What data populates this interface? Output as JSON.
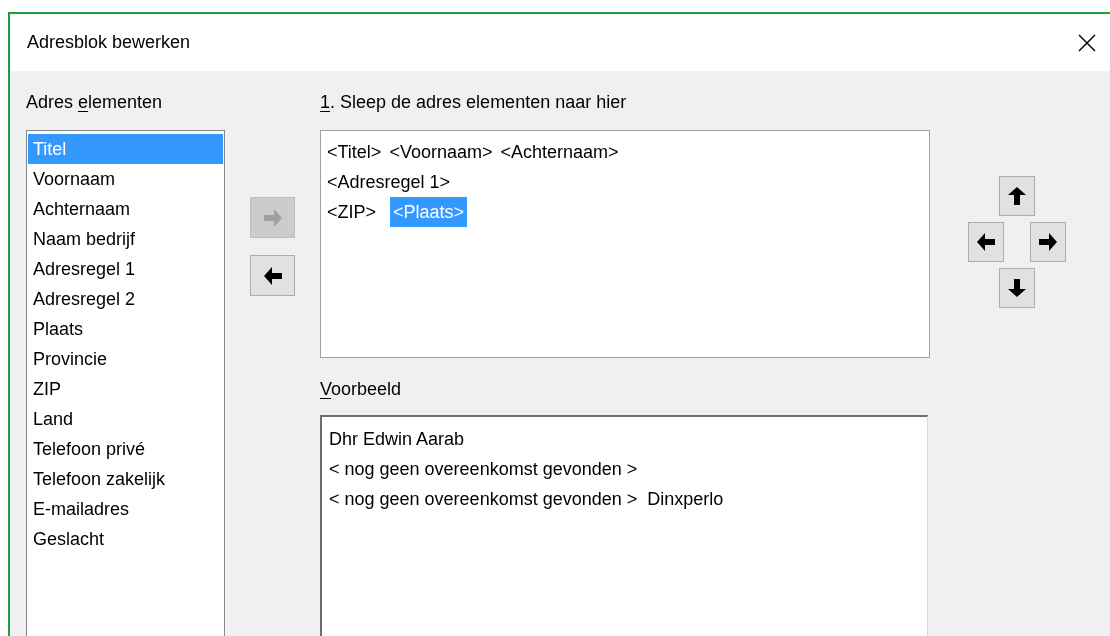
{
  "window": {
    "title": "Adresblok bewerken"
  },
  "elements_label": {
    "before": "Adres ",
    "access_key": "e",
    "after": "lementen"
  },
  "elements": [
    {
      "label": "Titel",
      "selected": true
    },
    {
      "label": "Voornaam",
      "selected": false
    },
    {
      "label": "Achternaam",
      "selected": false
    },
    {
      "label": "Naam bedrijf",
      "selected": false
    },
    {
      "label": "Adresregel 1",
      "selected": false
    },
    {
      "label": "Adresregel 2",
      "selected": false
    },
    {
      "label": "Plaats",
      "selected": false
    },
    {
      "label": "Provincie",
      "selected": false
    },
    {
      "label": "ZIP",
      "selected": false
    },
    {
      "label": "Land",
      "selected": false
    },
    {
      "label": "Telefoon privé",
      "selected": false
    },
    {
      "label": "Telefoon zakelijk",
      "selected": false
    },
    {
      "label": "E-mailadres",
      "selected": false
    },
    {
      "label": "Geslacht",
      "selected": false
    }
  ],
  "transfer_buttons": [
    {
      "kind": "add",
      "disabled": true
    },
    {
      "kind": "remove",
      "disabled": false
    }
  ],
  "block_label": {
    "access_key": "1",
    "after": ". Sleep de adres elementen naar hier"
  },
  "address_block": [
    {
      "tokens": [
        {
          "text": "<Titel>",
          "selected": false
        },
        {
          "text": "<Voornaam>",
          "selected": false
        },
        {
          "text": "<Achternaam>",
          "selected": false
        }
      ]
    },
    {
      "tokens": [
        {
          "text": "<Adresregel 1>",
          "selected": false
        }
      ]
    },
    {
      "tokens": [
        {
          "text": "<ZIP>",
          "selected": false
        },
        {
          "text": "<Plaats>",
          "selected": true
        }
      ]
    }
  ],
  "move_buttons": [
    {
      "kind": "up"
    },
    {
      "kind": "left"
    },
    {
      "kind": "right"
    },
    {
      "kind": "down"
    }
  ],
  "preview_label": {
    "access_key": "V",
    "after": "oorbeeld"
  },
  "preview_lines": [
    "Dhr Edwin Aarab",
    "< nog geen overeenkomst gevonden >",
    "< nog geen overeenkomst gevonden >  Dinxperlo"
  ]
}
